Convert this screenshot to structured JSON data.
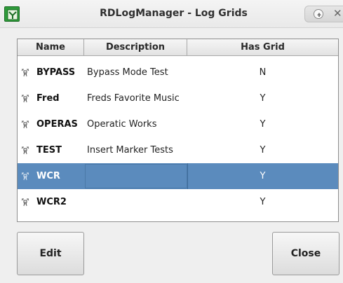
{
  "window": {
    "title": "RDLogManager - Log Grids",
    "controls": {
      "shade_icon": "up-arrow-icon",
      "close_glyph": "✕"
    }
  },
  "table": {
    "columns": [
      "Name",
      "Description",
      "Has Grid"
    ],
    "rows": [
      {
        "name": "BYPASS",
        "description": "Bypass Mode Test",
        "has_grid": "N",
        "selected": false
      },
      {
        "name": "Fred",
        "description": "Freds Favorite Music",
        "has_grid": "Y",
        "selected": false
      },
      {
        "name": "OPERAS",
        "description": "Operatic Works",
        "has_grid": "Y",
        "selected": false
      },
      {
        "name": "TEST",
        "description": "Insert Marker Tests",
        "has_grid": "Y",
        "selected": false
      },
      {
        "name": "WCR",
        "description": "",
        "has_grid": "Y",
        "selected": true
      },
      {
        "name": "WCR2",
        "description": "",
        "has_grid": "Y",
        "selected": false
      }
    ]
  },
  "buttons": {
    "edit": "Edit",
    "close": "Close"
  },
  "colors": {
    "selection": "#5b8bbd",
    "app_icon": "#2e9a3a"
  }
}
